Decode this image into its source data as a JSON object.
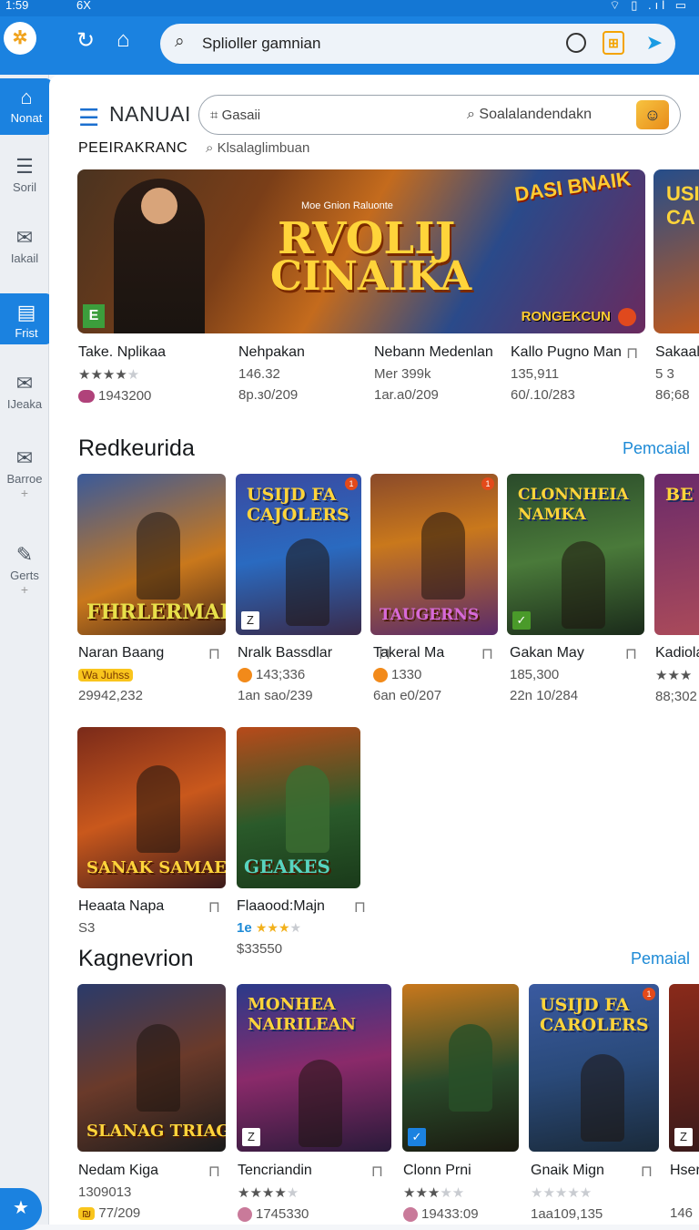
{
  "status": {
    "time": "1:59",
    "carrier": "6X",
    "icons": "⌔ ▯ .ıl ▭"
  },
  "topbar": {
    "search_text": "Splioller gamnian"
  },
  "sidebar": {
    "items": [
      {
        "label": "Nonat",
        "icon": "home-icon"
      },
      {
        "label": "Soril",
        "icon": "list-icon"
      },
      {
        "label": "Iakail",
        "icon": "mail-icon"
      },
      {
        "label": "Frist",
        "icon": "store-icon"
      },
      {
        "label": "IJeaka",
        "icon": "mail-icon"
      },
      {
        "label": "Barroe",
        "icon": "mail-icon"
      },
      {
        "label": "Gerts",
        "icon": "tag-icon"
      }
    ]
  },
  "header": {
    "brand": "NANUAI",
    "search_left": "Gasaii",
    "search_right": "Soalalandendakn",
    "subtitle": "PEEIRAKRANC",
    "subsearch": "Klsalaglimbuan"
  },
  "banner": {
    "pre_title": "Moe Gnion Raluonte",
    "title_line1": "RVOLIJ",
    "title_line2": "CINAIKA",
    "corner_logo": "DASI BNAIK",
    "corner_bottom": "RONGEKCUN",
    "side_text": "USI CA"
  },
  "featured": [
    {
      "title": "Take. Nplikaa",
      "stars": 4,
      "line3": "1943200"
    },
    {
      "title": "Nehpakan",
      "line2": "146.32",
      "line3": "8p.з0/209"
    },
    {
      "title": "Nebann Medenlan",
      "line2": "Mer 399k",
      "line3": "1ar.a0/209"
    },
    {
      "title": "Kallo Pugno Man",
      "line2": "135,911",
      "line3": "60/.10/283"
    },
    {
      "title": "Sakaal",
      "line2": "5 3",
      "line3": "86;68"
    }
  ],
  "sections": [
    {
      "title": "Redkeurida",
      "more": "Pemcaial",
      "cards": [
        {
          "title": "Naran Baang",
          "chip": "Wa Juhss",
          "line3": "29942,232",
          "tile_text": "FHRLERMAIY"
        },
        {
          "title": "Nralk Bassdlar",
          "line2": "143;336",
          "line3": "1an sao/239",
          "tile_text": "USIJD FA CAJOLERS"
        },
        {
          "title": "Takeral Ma",
          "line2": "1330",
          "line3": "6an e0/207",
          "tile_text": "TAUGERNS"
        },
        {
          "title": "Gakan May",
          "line2": "185,300",
          "line3": "22n 10/284",
          "tile_text": "CLONNHEIA NAMKA"
        },
        {
          "title": "Kadiola",
          "stars": 3,
          "line3": "88;302",
          "tile_text": "BE"
        }
      ]
    },
    {
      "title": "",
      "more": "",
      "cards": [
        {
          "title": "Heaata Napa",
          "line2": "S3",
          "tile_text": "SANAK SAMAE"
        },
        {
          "title": "Flaaood:Majn",
          "prefix": "1e",
          "stars": 3,
          "line3": "$33550",
          "tile_text": "GEAKES"
        }
      ]
    },
    {
      "title": "Kagnevrion",
      "more": "Pemaial",
      "cards": [
        {
          "title": "Nedam Kiga",
          "line2": "1309013",
          "line3": "77/209",
          "tile_text": "SLANAG TRIAGRHAN"
        },
        {
          "title": "Tencriandin",
          "stars": 4,
          "line3": "1745330",
          "tile_text": "MONHEA NAIRILEAN"
        },
        {
          "title": "Clonn Prni",
          "stars": 3,
          "line3": "19433:09",
          "tile_text": ""
        },
        {
          "title": "Gnaik Mign",
          "stars": 0,
          "line3": "1aa109,135",
          "tile_text": "USIJD FA CAROLERS"
        },
        {
          "title": "Hser",
          "line3": "146",
          "tile_text": ""
        }
      ]
    }
  ],
  "colors": {
    "accent": "#1b82e0",
    "link": "#1d8ad6",
    "star": "#f2b11c"
  }
}
